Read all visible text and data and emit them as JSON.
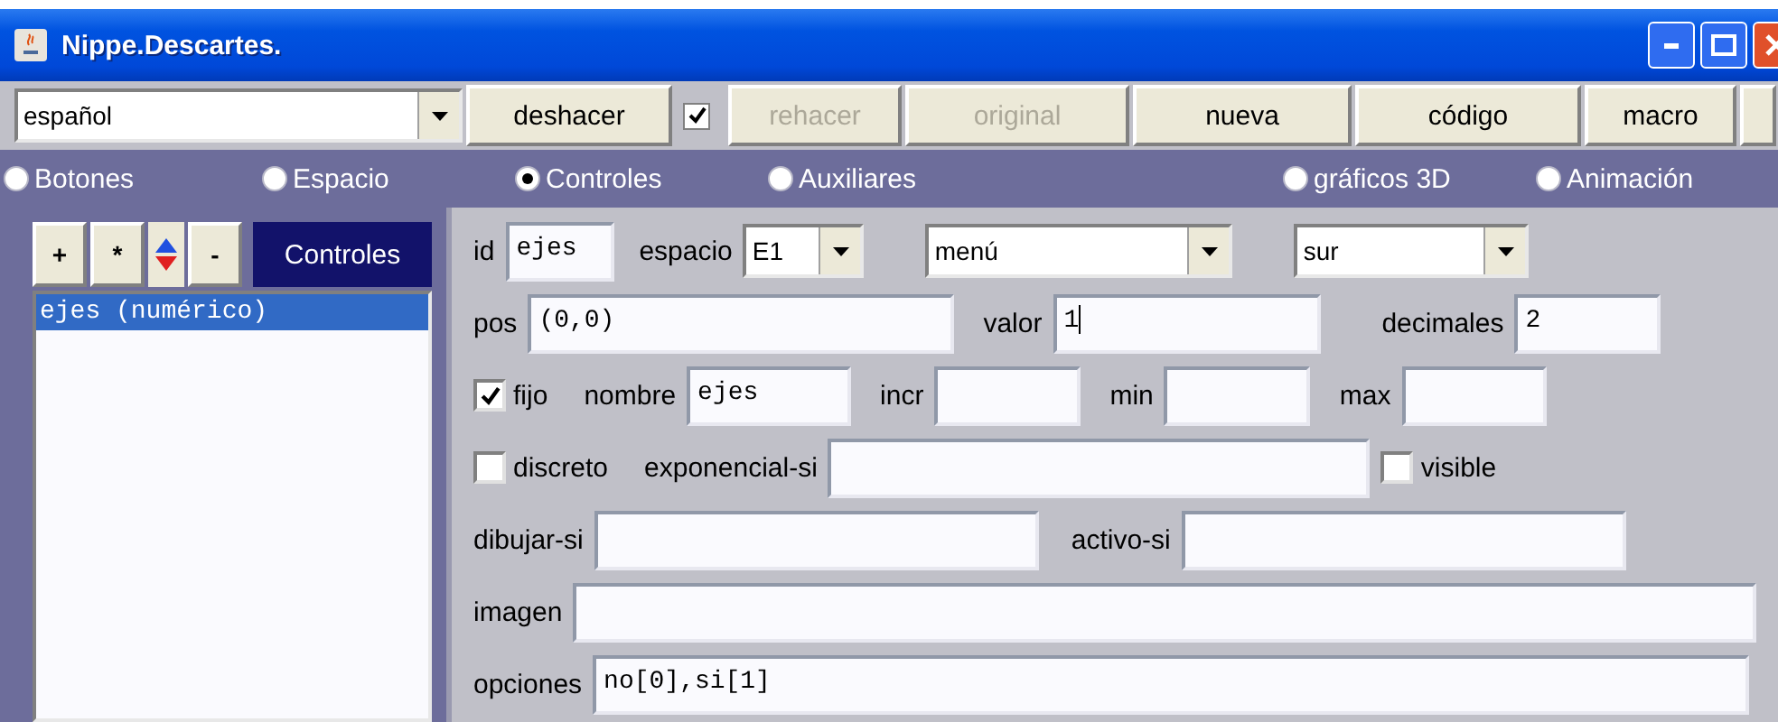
{
  "window": {
    "title": "Nippe.Descartes."
  },
  "toolbar": {
    "language": "español",
    "buttons": [
      {
        "label": "deshacer",
        "disabled": false
      },
      {
        "kind": "checkbox",
        "checked": true
      },
      {
        "label": "rehacer",
        "disabled": true
      },
      {
        "label": "original",
        "disabled": true
      },
      {
        "label": "nueva",
        "disabled": false
      },
      {
        "label": "código",
        "disabled": false
      },
      {
        "label": "macro",
        "disabled": false
      },
      {
        "kind": "partial"
      }
    ]
  },
  "sections": [
    {
      "label": "Botones",
      "selected": false
    },
    {
      "label": "Espacio",
      "selected": false
    },
    {
      "label": "Controles",
      "selected": true
    },
    {
      "label": "Auxiliares",
      "selected": false
    },
    {
      "label": "gráficos 3D",
      "selected": false
    },
    {
      "label": "Animación",
      "selected": false
    }
  ],
  "list_panel": {
    "buttons": [
      "+",
      "*",
      "-"
    ],
    "title": "Controles",
    "items": [
      {
        "label": "ejes (numérico)",
        "selected": true
      }
    ]
  },
  "form_rows": [
    [
      {
        "kind": "label",
        "text": "id"
      },
      {
        "kind": "field",
        "value": "ejes"
      },
      {
        "kind": "label",
        "text": "espacio"
      },
      {
        "kind": "select",
        "value": "E1"
      },
      {
        "kind": "select",
        "value": "menú"
      },
      {
        "kind": "select",
        "value": "sur"
      }
    ],
    [
      {
        "kind": "label",
        "text": "pos"
      },
      {
        "kind": "field",
        "value": "(0,0)"
      },
      {
        "kind": "label",
        "text": "valor"
      },
      {
        "kind": "field",
        "value": "1",
        "focused": true
      },
      {
        "kind": "label",
        "text": "decimales"
      },
      {
        "kind": "field",
        "value": "2"
      }
    ],
    [
      {
        "kind": "checkbox",
        "text": "fijo",
        "checked": true
      },
      {
        "kind": "label",
        "text": "nombre"
      },
      {
        "kind": "field",
        "value": "ejes"
      },
      {
        "kind": "label",
        "text": "incr"
      },
      {
        "kind": "field"
      },
      {
        "kind": "label",
        "text": "min"
      },
      {
        "kind": "field"
      },
      {
        "kind": "label",
        "text": "max"
      },
      {
        "kind": "field"
      }
    ],
    [
      {
        "kind": "checkbox",
        "text": "discreto",
        "checked": false
      },
      {
        "kind": "label",
        "text": "exponencial-si"
      },
      {
        "kind": "field"
      },
      {
        "kind": "checkbox",
        "text": "visible",
        "checked": false
      }
    ],
    [
      {
        "kind": "label",
        "text": "dibujar-si"
      },
      {
        "kind": "field"
      },
      {
        "kind": "label",
        "text": "activo-si"
      },
      {
        "kind": "field"
      }
    ],
    [
      {
        "kind": "label",
        "text": "imagen"
      },
      {
        "kind": "field"
      }
    ],
    [
      {
        "kind": "label",
        "text": "opciones"
      },
      {
        "kind": "field",
        "value": "no[0],si[1]"
      }
    ]
  ]
}
